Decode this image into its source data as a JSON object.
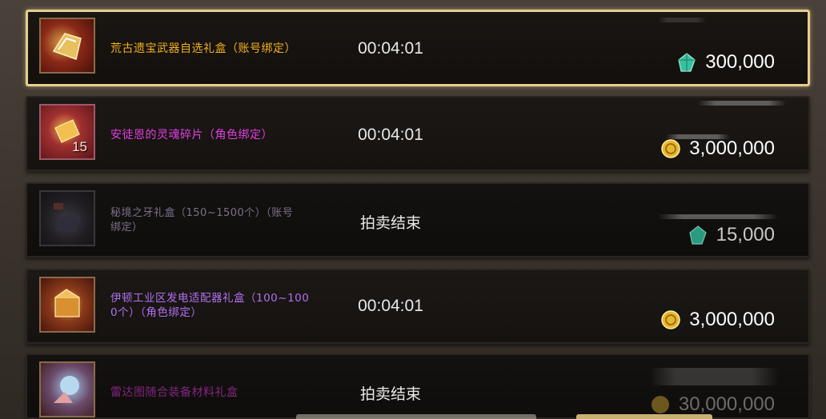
{
  "listings": [
    {
      "name": "荒古遗宝武器自选礼盒（账号绑定）",
      "name_color": "#f0b020",
      "icon": "weapon-box-icon",
      "stack": "",
      "timer": "00:04:01",
      "price": "300,000",
      "currency": "diamond-gem-icon",
      "selected": true
    },
    {
      "name": "安徒恩的灵魂碎片（角色绑定）",
      "name_color": "#e040e0",
      "icon": "soul-fragment-icon",
      "stack": "15",
      "timer": "00:04:01",
      "price": "3,000,000",
      "currency": "gold-coin-icon",
      "selected": false
    },
    {
      "name_line1": "秘境之牙礼盒（150~1500个）（账号",
      "name_line2": "绑定）",
      "name_color": "#7a7088",
      "icon": "fang-box-icon",
      "stack": "",
      "status": "拍卖结束",
      "price": "15,000",
      "currency": "diamond-gem-icon",
      "selected": false
    },
    {
      "name_line1": "伊顿工业区发电适配器礼盒（100~100",
      "name_line2": "0个）（角色绑定）",
      "name_color": "#b070f0",
      "icon": "adapter-box-icon",
      "stack": "",
      "timer": "00:04:01",
      "price": "3,000,000",
      "currency": "gold-coin-icon",
      "selected": false
    },
    {
      "name": "雷达图随合装备材料礼盒",
      "name_color": "#b030b0",
      "icon": "material-box-icon",
      "stack": "",
      "status": "拍卖结束",
      "price": "30,000,000",
      "currency": "gold-coin-icon",
      "selected": false
    }
  ]
}
